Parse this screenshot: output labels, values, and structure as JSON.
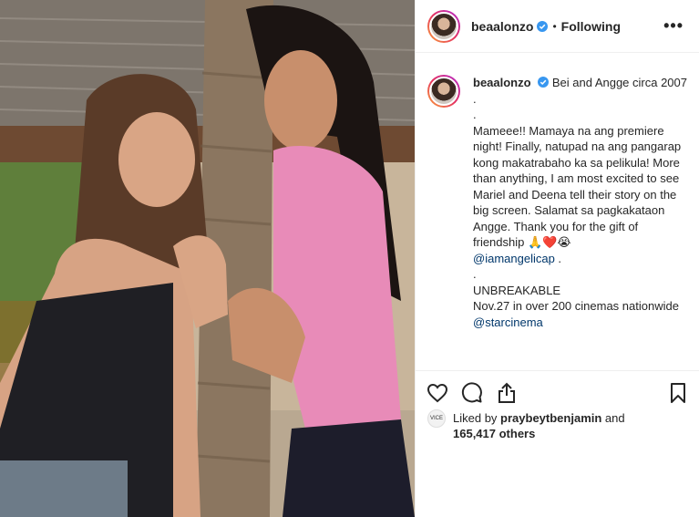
{
  "header": {
    "username": "beaalonzo",
    "separator": "•",
    "follow_label": "Following",
    "more_label": "•••"
  },
  "caption": {
    "username": "beaalonzo",
    "line1": "Bei and Angge circa 2007 .",
    "dot1": ".",
    "body": "Mameee!! Mamaya na ang premiere night! Finally, natupad na ang pangarap kong makatrabaho ka sa pelikula! More than anything, I am most excited to see Mariel and Deena tell their story on the big screen. Salamat sa pagkakataon Angge. Thank you for the gift of friendship",
    "emojis": "🙏❤️😭",
    "mention1": "@iamangelicap",
    "mention1_after": " .",
    "dot2": ".",
    "unbreakable": "UNBREAKABLE",
    "release": "Nov.27 in over 200 cinemas nationwide",
    "mention2": "@starcinema"
  },
  "likes": {
    "badge": "VICE",
    "prefix": "Liked by ",
    "user": "praybeytbenjamin",
    "and": " and",
    "count": "165,417 others"
  },
  "icons": {
    "like": "heart-icon",
    "comment": "comment-icon",
    "share": "share-icon",
    "save": "bookmark-icon",
    "verified": "verified-badge-icon"
  },
  "colors": {
    "verified": "#3897f0",
    "mention": "#00376b",
    "text": "#262626",
    "border": "#efefef"
  }
}
